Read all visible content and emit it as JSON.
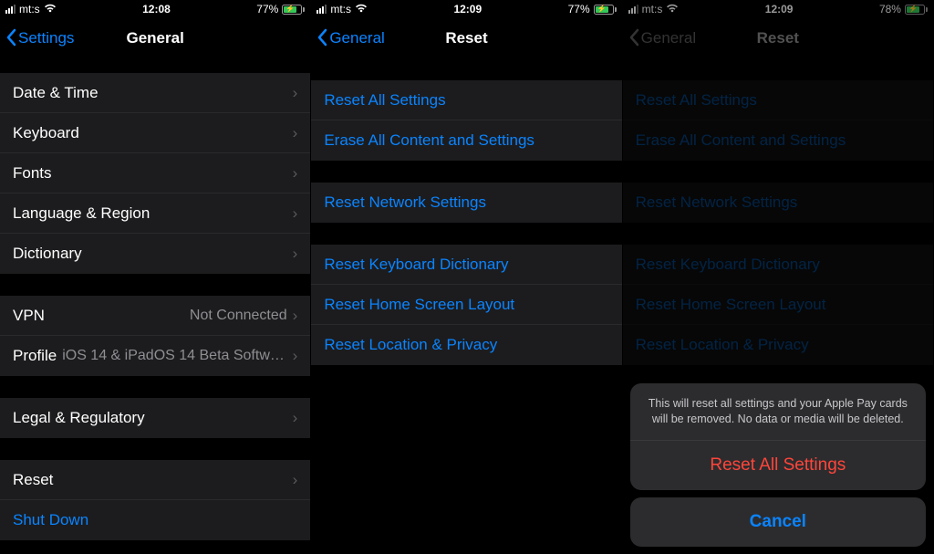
{
  "panels": [
    {
      "status": {
        "carrier": "mt:s",
        "time": "12:08",
        "battery_pct": "77%"
      },
      "nav": {
        "back": "Settings",
        "title": "General"
      },
      "groups": [
        [
          {
            "label": "Date & Time"
          },
          {
            "label": "Keyboard"
          },
          {
            "label": "Fonts"
          },
          {
            "label": "Language & Region"
          },
          {
            "label": "Dictionary"
          }
        ],
        [
          {
            "label": "VPN",
            "value": "Not Connected"
          },
          {
            "label": "Profile",
            "value": "iOS 14 & iPadOS 14 Beta Softwar..."
          }
        ],
        [
          {
            "label": "Legal & Regulatory"
          }
        ],
        [
          {
            "label": "Reset"
          },
          {
            "label": "Shut Down",
            "link": true,
            "no_chev": true
          }
        ]
      ]
    },
    {
      "status": {
        "carrier": "mt:s",
        "time": "12:09",
        "battery_pct": "77%"
      },
      "nav": {
        "back": "General",
        "title": "Reset"
      },
      "groups": [
        [
          {
            "label": "Reset All Settings",
            "link": true,
            "no_chev": true
          },
          {
            "label": "Erase All Content and Settings",
            "link": true,
            "no_chev": true
          }
        ],
        [
          {
            "label": "Reset Network Settings",
            "link": true,
            "no_chev": true
          }
        ],
        [
          {
            "label": "Reset Keyboard Dictionary",
            "link": true,
            "no_chev": true
          },
          {
            "label": "Reset Home Screen Layout",
            "link": true,
            "no_chev": true
          },
          {
            "label": "Reset Location & Privacy",
            "link": true,
            "no_chev": true
          }
        ]
      ]
    },
    {
      "status": {
        "carrier": "mt:s",
        "time": "12:09",
        "battery_pct": "78%"
      },
      "nav": {
        "back": "General",
        "title": "Reset",
        "dim": true
      },
      "groups": [
        [
          {
            "label": "Reset All Settings",
            "link": true,
            "no_chev": true,
            "dim": true
          },
          {
            "label": "Erase All Content and Settings",
            "link": true,
            "no_chev": true,
            "dim": true
          }
        ],
        [
          {
            "label": "Reset Network Settings",
            "link": true,
            "no_chev": true,
            "dim": true
          }
        ],
        [
          {
            "label": "Reset Keyboard Dictionary",
            "link": true,
            "no_chev": true,
            "dim": true
          },
          {
            "label": "Reset Home Screen Layout",
            "link": true,
            "no_chev": true,
            "dim": true
          },
          {
            "label": "Reset Location & Privacy",
            "link": true,
            "no_chev": true,
            "dim": true
          }
        ]
      ],
      "action_sheet": {
        "message": "This will reset all settings and your Apple Pay cards will be removed. No data or media will be deleted.",
        "destructive": "Reset All Settings",
        "cancel": "Cancel"
      }
    }
  ]
}
